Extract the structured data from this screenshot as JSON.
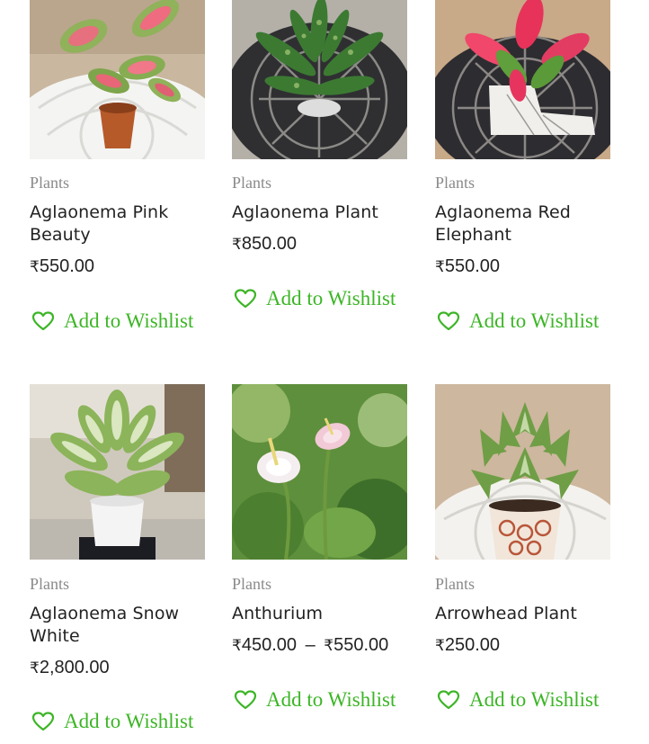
{
  "products": [
    {
      "category": "Plants",
      "name": "Aglaonema Pink Beauty",
      "price": "550.00",
      "price_high": "",
      "wishlist_label": "Add to Wishlist",
      "image_desc": "pink-green aglaonema in terracotta pot on white table"
    },
    {
      "category": "Plants",
      "name": "Aglaonema Plant",
      "price": "850.00",
      "price_high": "",
      "wishlist_label": "Add to Wishlist",
      "image_desc": "green speckled aglaonema on black metal table"
    },
    {
      "category": "Plants",
      "name": "Aglaonema Red Elephant",
      "price": "550.00",
      "price_high": "",
      "wishlist_label": "Add to Wishlist",
      "image_desc": "red aglaonema in white shoe-shaped planter"
    },
    {
      "category": "Plants",
      "name": "Aglaonema Snow White",
      "price": "2,800.00",
      "price_high": "",
      "wishlist_label": "Add to Wishlist",
      "image_desc": "white-green aglaonema in white pot on stand"
    },
    {
      "category": "Plants",
      "name": "Anthurium",
      "price": "450.00",
      "price_high": "550.00",
      "wishlist_label": "Add to Wishlist",
      "image_desc": "white anthurium flowers among green leaves"
    },
    {
      "category": "Plants",
      "name": "Arrowhead Plant",
      "price": "250.00",
      "price_high": "",
      "wishlist_label": "Add to Wishlist",
      "image_desc": "arrowhead plant in patterned ceramic pot"
    }
  ],
  "currency_symbol": "₹",
  "range_separator": "–",
  "colors": {
    "wishlist_green": "#3cb526",
    "category_grey": "#8a8a8a",
    "text_dark": "#222222"
  },
  "icons": {
    "wishlist": "heart-outline-icon"
  }
}
